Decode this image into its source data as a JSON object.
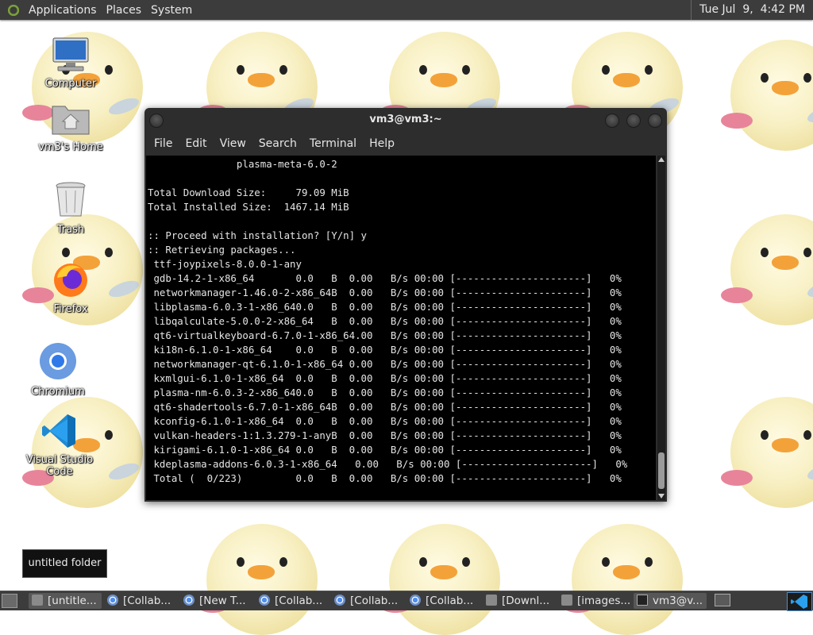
{
  "top_panel": {
    "menus": [
      "Applications",
      "Places",
      "System"
    ],
    "clock": "Tue Jul  9,  4:42 PM"
  },
  "desktop_icons": [
    {
      "label": "Computer",
      "icon": "computer-icon"
    },
    {
      "label": "vm3's Home",
      "icon": "home-folder-icon"
    },
    {
      "label": "Trash",
      "icon": "trash-icon"
    },
    {
      "label": "Firefox",
      "icon": "firefox-icon"
    },
    {
      "label": "Chromium",
      "icon": "chromium-icon"
    },
    {
      "label": "Visual Studio Code",
      "icon": "vscode-icon"
    }
  ],
  "terminal": {
    "title": "vm3@vm3:~",
    "menu": [
      "File",
      "Edit",
      "View",
      "Search",
      "Terminal",
      "Help"
    ],
    "lines": [
      "               plasma-meta-6.0-2",
      "",
      "Total Download Size:     79.09 MiB",
      "Total Installed Size:  1467.14 MiB",
      "",
      ":: Proceed with installation? [Y/n] y",
      ":: Retrieving packages...",
      " ttf-joypixels-8.0.0-1-any",
      " gdb-14.2-1-x86_64       0.0   B  0.00   B/s 00:00 [----------------------]   0%",
      " networkmanager-1.46.0-2-x86_64B  0.00   B/s 00:00 [----------------------]   0%",
      " libplasma-6.0.3-1-x86_640.0   B  0.00   B/s 00:00 [----------------------]   0%",
      " libqalculate-5.0.0-2-x86_64   B  0.00   B/s 00:00 [----------------------]   0%",
      " qt6-virtualkeyboard-6.7.0-1-x86_64.00   B/s 00:00 [----------------------]   0%",
      " ki18n-6.1.0-1-x86_64    0.0   B  0.00   B/s 00:00 [----------------------]   0%",
      " networkmanager-qt-6.1.0-1-x86_64 0.00   B/s 00:00 [----------------------]   0%",
      " kxmlgui-6.1.0-1-x86_64  0.0   B  0.00   B/s 00:00 [----------------------]   0%",
      " plasma-nm-6.0.3-2-x86_640.0   B  0.00   B/s 00:00 [----------------------]   0%",
      " qt6-shadertools-6.7.0-1-x86_64B  0.00   B/s 00:00 [----------------------]   0%",
      " kconfig-6.1.0-1-x86_64  0.0   B  0.00   B/s 00:00 [----------------------]   0%",
      " vulkan-headers-1:1.3.279-1-anyB  0.00   B/s 00:00 [----------------------]   0%",
      " kirigami-6.1.0-1-x86_64 0.0   B  0.00   B/s 00:00 [----------------------]   0%",
      " kdeplasma-addons-6.0.3-1-x86_64   0.00   B/s 00:00 [----------------------]   0%",
      " Total (  0/223)         0.0   B  0.00   B/s 00:00 [----------------------]   0%"
    ]
  },
  "tooltip": "untitled folder",
  "taskbar": {
    "tasks": [
      {
        "label": "[untitle...",
        "icon": "folder-icon",
        "active": true
      },
      {
        "label": "[Collab...",
        "icon": "chromium-icon",
        "active": false
      },
      {
        "label": "[New T...",
        "icon": "chromium-icon",
        "active": false
      },
      {
        "label": "[Collab...",
        "icon": "chromium-icon",
        "active": false
      },
      {
        "label": "[Collab...",
        "icon": "chromium-icon",
        "active": false
      },
      {
        "label": "[Collab...",
        "icon": "chromium-icon",
        "active": false
      },
      {
        "label": "[Downl...",
        "icon": "folder-icon",
        "active": false
      },
      {
        "label": "[images...",
        "icon": "folder-icon",
        "active": false
      },
      {
        "label": "vm3@v...",
        "icon": "terminal-icon",
        "active": true
      }
    ]
  }
}
